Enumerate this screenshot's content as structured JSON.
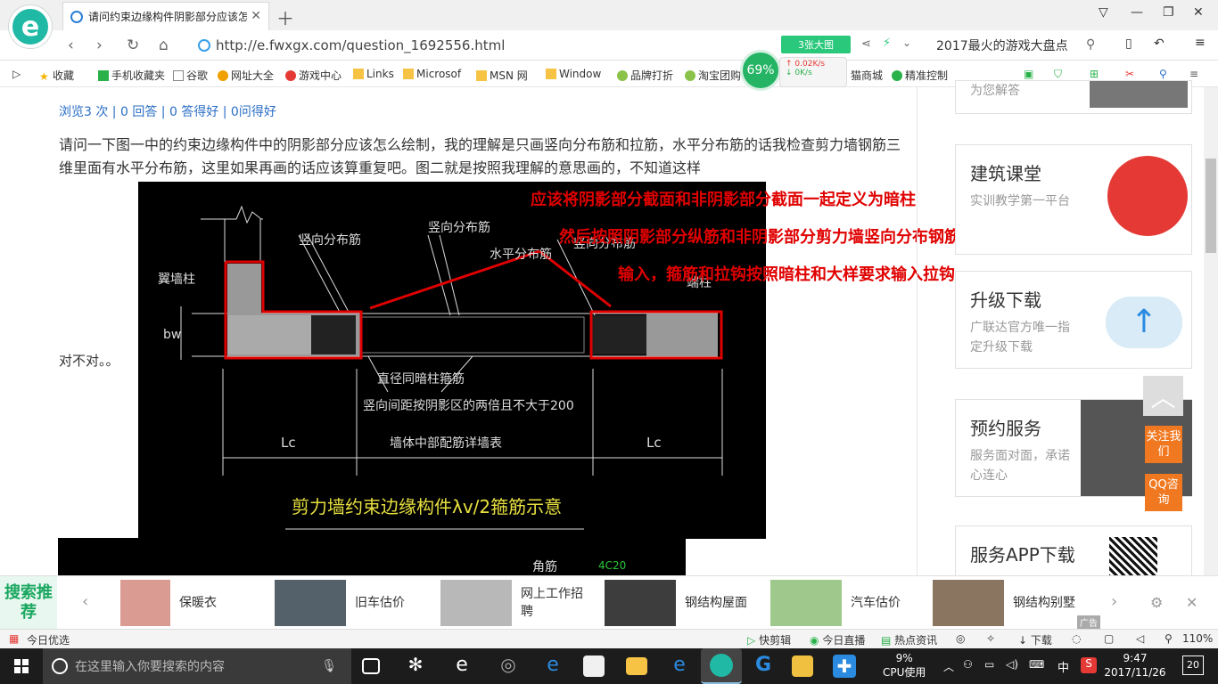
{
  "browser": {
    "tab_title": "请问约束边缘构件阴影部分应该怎",
    "url": "http://e.fwxgx.com/question_1692556.html",
    "bigpic_label": "3张大图",
    "search_hint": "2017最火的游戏大盘点"
  },
  "favorites": [
    "收藏",
    "手机收藏夹",
    "谷歌",
    "网址大全",
    "游戏中心",
    "Links",
    "Microsof",
    "MSN 网",
    "Window",
    "品牌打折",
    "淘宝团购",
    "猫商城",
    "精准控制"
  ],
  "speed": {
    "percent": "69%",
    "up": "0.02K/s",
    "down": "0K/s"
  },
  "question": {
    "stats": "浏览3 次 | 0 回答 | 0 答得好 | 0问得好",
    "text": "请问一下图一中的约束边缘构件中的阴影部分应该怎么绘制，我的理解是只画竖向分布筋和拉筋，水平分布筋的话我检查剪力墙钢筋三维里面有水平分布筋，这里如果再画的话应该算重复吧。图二就是按照我理解的意思画的，不知道这样",
    "ending": "对不对。。"
  },
  "cad": {
    "annotations": [
      "应该将阴影部分截面和非阴影部分截面一起定义为暗柱",
      "然后按照阴影部分纵筋和非阴影部分剪力墙竖向分布钢筋",
      "输入，箍筋和拉钩按照暗柱和大样要求输入拉钩"
    ],
    "labels": {
      "wall_column": "翼墙柱",
      "vert_bar_1": "竖向分布筋",
      "vert_bar_2": "竖向分布筋",
      "horiz_bar": "水平分布筋",
      "vert_bar_3": "竖向分布筋",
      "end_column": "端柱",
      "bw": "bw",
      "stirrup_dia": "直径同暗柱箍筋",
      "spacing": "竖向间距按阴影区的两倍且不大于200",
      "wall_note": "墙体中部配筋详墙表",
      "lc_left": "Lc",
      "lc_right": "Lc",
      "caption": "剪力墙约束边缘构件λv/2箍筋示意",
      "corner_bar": "角筋",
      "corner_bar_val": "4C20"
    }
  },
  "sidebar": {
    "cards": [
      {
        "title": "为您解答",
        "sub": ""
      },
      {
        "title": "建筑课堂",
        "sub": "实训教学第一平台"
      },
      {
        "title": "升级下载",
        "sub": "广联达官方唯一指定升级下载"
      },
      {
        "title": "预约服务",
        "sub": "服务面对面，承诺心连心"
      },
      {
        "title": "服务APP下载",
        "sub": ""
      }
    ],
    "follow_btn": "关注我们",
    "qq_btn": "QQ咨询"
  },
  "adbar": {
    "label": "搜索推荐",
    "items": [
      "保暖衣",
      "旧车估价",
      "网上工作招聘",
      "钢结构屋面",
      "汽车估价",
      "钢结构别墅"
    ],
    "ad_tag": "广告"
  },
  "statusbar": {
    "left": "今日优选",
    "items": [
      "快剪辑",
      "今日直播",
      "热点资讯",
      "下载"
    ],
    "zoom": "110%"
  },
  "taskbar": {
    "search_placeholder": "在这里输入你要搜索的内容",
    "cpu": "9%",
    "cpu_label": "CPU使用",
    "ime": "中",
    "time": "9:47",
    "date": "2017/11/26",
    "notif": "20"
  },
  "colors": {
    "accent": "#1fb9a5",
    "link": "#2a6ec6",
    "annotation": "#e00000",
    "orange": "#f07820"
  }
}
